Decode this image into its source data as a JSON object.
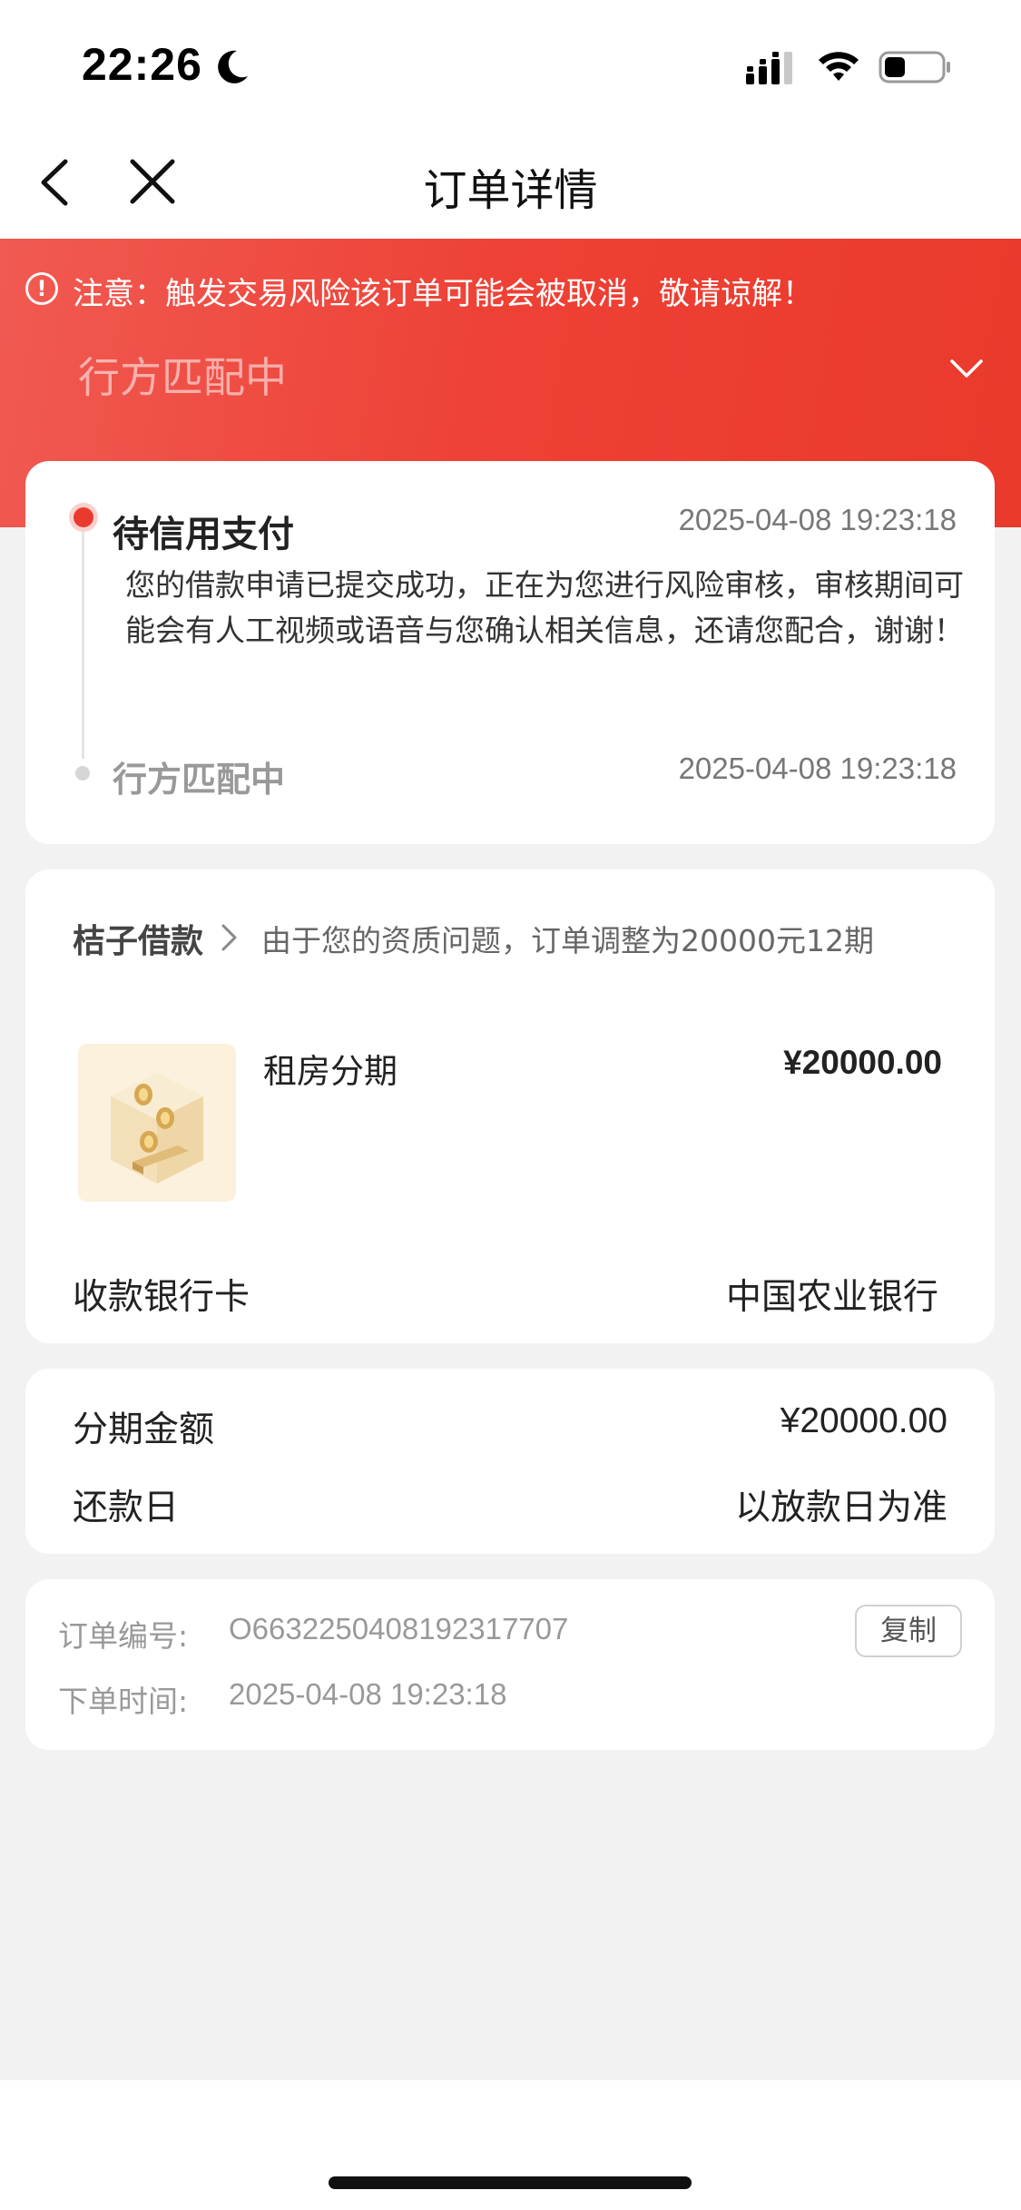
{
  "status_bar": {
    "time": "22:26"
  },
  "nav": {
    "title": "订单详情"
  },
  "header": {
    "notice": "注意：触发交易风险该订单可能会被取消，敬请谅解！",
    "status_title": "行方匹配中",
    "accent_color": "#ea3a2f"
  },
  "timeline": {
    "steps": [
      {
        "title": "待信用支付",
        "time": "2025-04-08 19:23:18",
        "desc": "您的借款申请已提交成功，正在为您进行风险审核，审核期间可能会有人工视频或语音与您确认相关信息，还请您配合，谢谢！"
      },
      {
        "title": "行方匹配中",
        "time": "2025-04-08 19:23:18"
      }
    ]
  },
  "loan": {
    "lender": "桔子借款",
    "note": "由于您的资质问题，订单调整为20000元12期",
    "product_name": "租房分期",
    "product_price": "¥20000.00",
    "bank_label": "收款银行卡",
    "bank_value": "中国农业银行"
  },
  "amounts": {
    "amount_label": "分期金额",
    "amount_value": "¥20000.00",
    "repay_label": "还款日",
    "repay_value": "以放款日为准"
  },
  "order": {
    "number_label": "订单编号:",
    "number_value": "O6632250408192317707",
    "copy_label": "复制",
    "time_label": "下单时间:",
    "time_value": "2025-04-08 19:23:18"
  }
}
